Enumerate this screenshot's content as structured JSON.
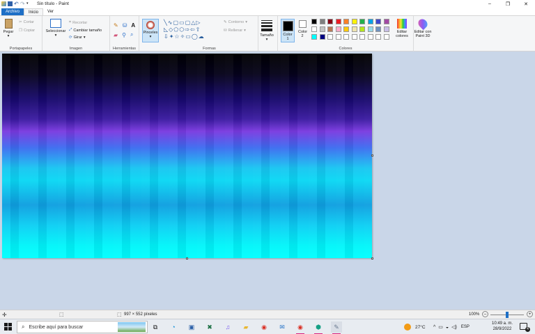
{
  "window": {
    "title": "Sin título - Paint",
    "controls": {
      "minimize": "–",
      "maximize": "❐",
      "close": "✕"
    }
  },
  "menu": {
    "file": "Archivo",
    "tabs": [
      "Inicio",
      "Ver"
    ]
  },
  "ribbon": {
    "clipboard": {
      "paste": "Pegar",
      "cut": "Cortar",
      "copy": "Copiar",
      "label": "Portapapeles"
    },
    "image": {
      "select": "Seleccionar",
      "crop": "Recortar",
      "resize": "Cambiar tamaño",
      "rotate": "Girar",
      "label": "Imagen"
    },
    "tools": {
      "label": "Herramientas",
      "text_tool": "A"
    },
    "brushes": {
      "label": "Pinceles"
    },
    "shapes": {
      "outline": "Contorno",
      "fill": "Rellenar",
      "label": "Formas"
    },
    "size": {
      "label": "Tamaño"
    },
    "colors": {
      "color1": "Color 1",
      "color2": "Color 2",
      "edit": "Editar colores",
      "label": "Colores",
      "color1_value": "#000000",
      "color2_value": "#ffffff",
      "palette": [
        "#000000",
        "#7f7f7f",
        "#880015",
        "#ed1c24",
        "#ff7f27",
        "#fff200",
        "#22b14c",
        "#00a2e8",
        "#3f48cc",
        "#a349a4",
        "#ffffff",
        "#c3c3c3",
        "#b97a57",
        "#ffaec9",
        "#ffc90e",
        "#efe4b0",
        "#b5e61d",
        "#99d9ea",
        "#7092be",
        "#c8bfe7",
        "#00ffff",
        "#000080",
        "#ffffff",
        "#ffffff",
        "#ffffff",
        "#ffffff",
        "#ffffff",
        "#ffffff",
        "#ffffff",
        "#ffffff"
      ]
    },
    "paint3d": {
      "label": "Editar con Paint 3D"
    }
  },
  "status": {
    "dimensions": "997 × 552 píxeles",
    "zoom": "100%",
    "zoom_minus": "–",
    "zoom_plus": "+"
  },
  "taskbar": {
    "search_placeholder": "Escribe aquí para buscar",
    "temperature": "27°C",
    "language": "ESP",
    "time": "10:49 a. m.",
    "date": "28/9/2022",
    "notification_count": "4"
  }
}
